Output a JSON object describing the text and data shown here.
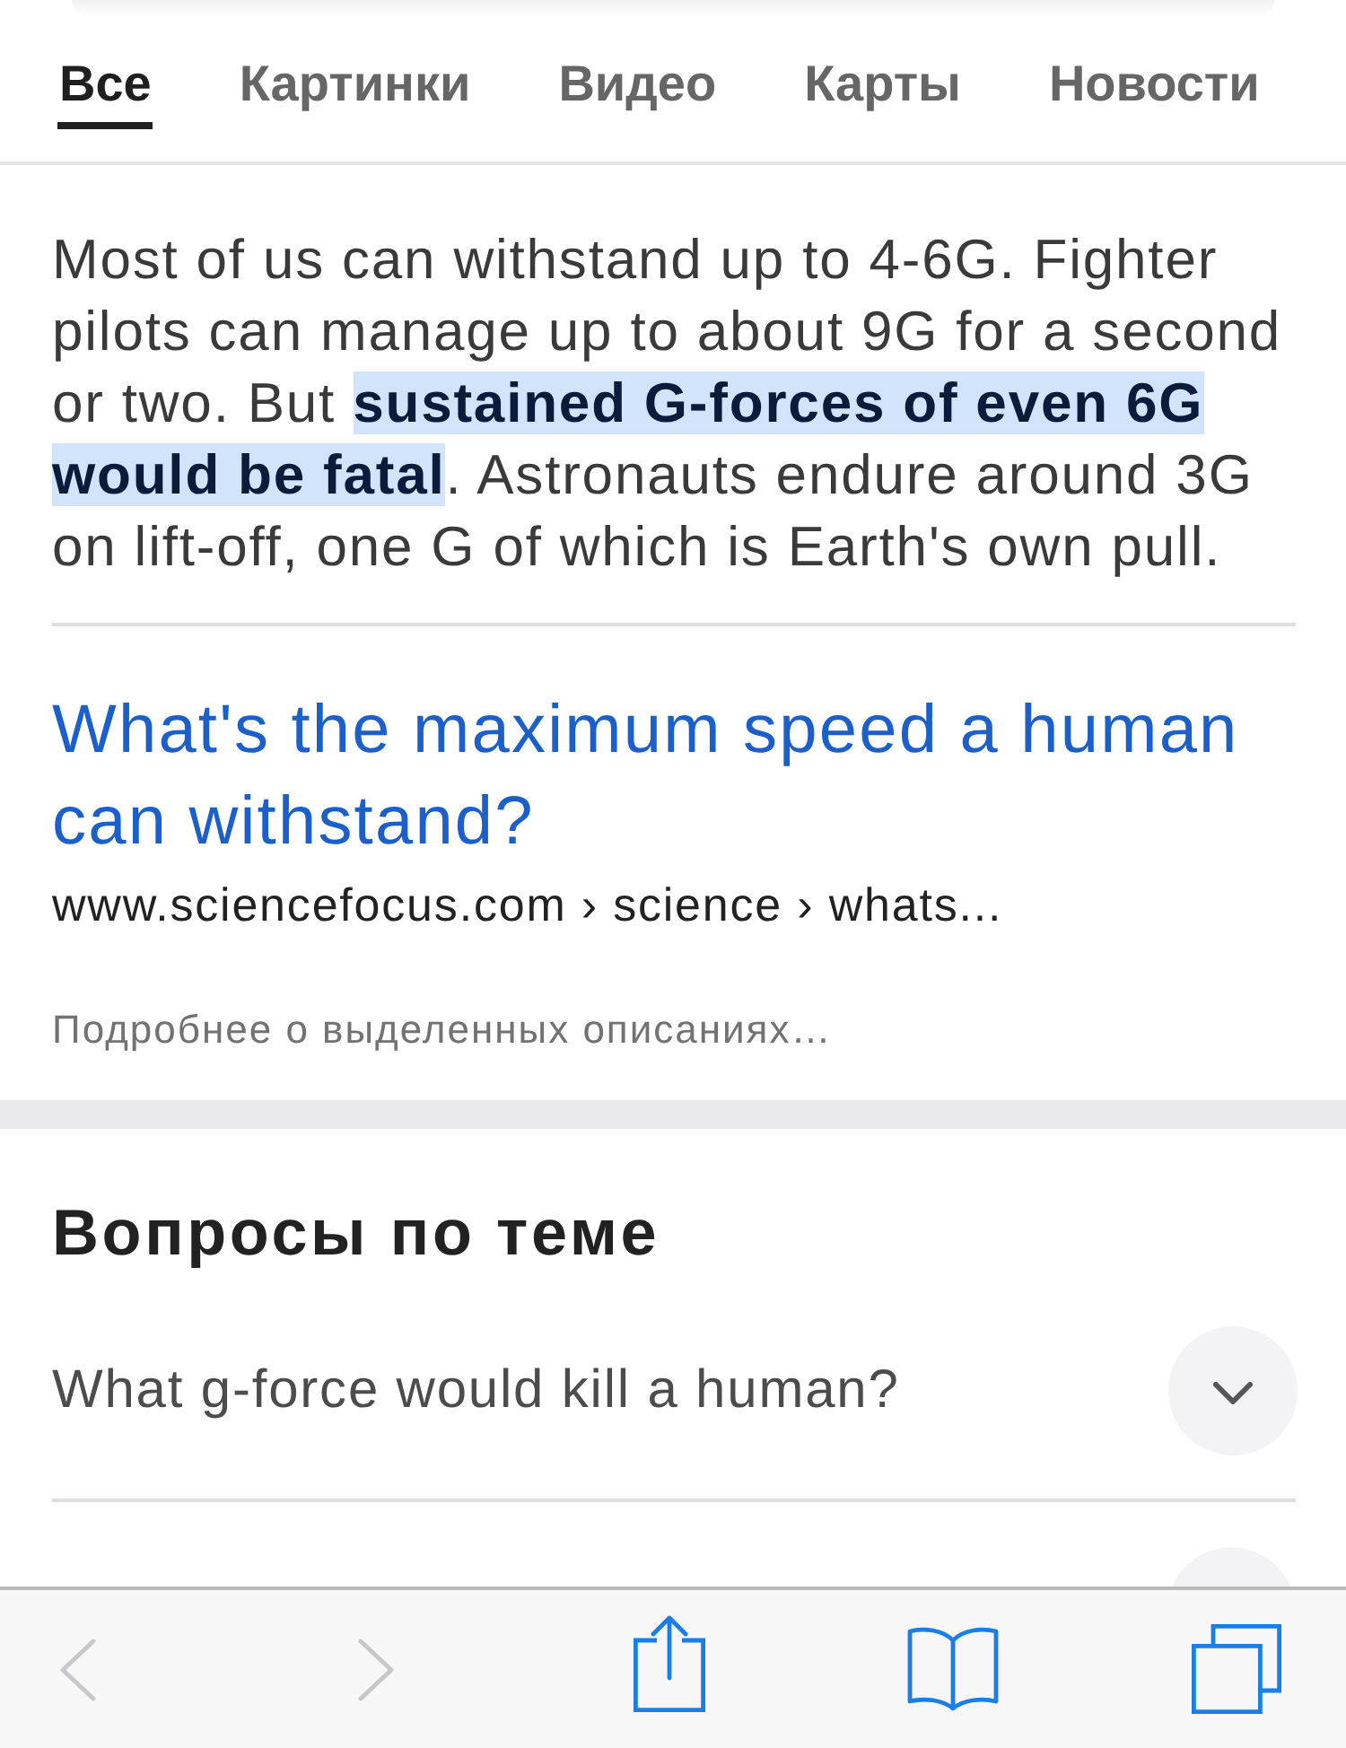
{
  "tabs": [
    {
      "label": "Все",
      "selected": true
    },
    {
      "label": "Картинки",
      "selected": false
    },
    {
      "label": "Видео",
      "selected": false
    },
    {
      "label": "Карты",
      "selected": false
    },
    {
      "label": "Новости",
      "selected": false
    }
  ],
  "featured_snippet": {
    "text": "Most of us can withstand up to 4-6G. Fighter pilots can manage up to about 9G for a second or two. But **sustained G-forces of even 6G would be fatal**. Astronauts endure around 3G on lift-off, one G of which is Earth's own pull.",
    "link_title": "What's the maximum speed a human can withstand?",
    "url": "www.sciencefocus.com › science › whats...",
    "about_link": "Подробнее о выделенных описаниях…"
  },
  "related_questions": {
    "heading": "Вопросы по теме",
    "items": [
      {
        "question": "What g-force would kill a human?",
        "expanded": false
      }
    ]
  },
  "toolbar": [
    {
      "kind": "back",
      "disabled": true
    },
    {
      "kind": "forward",
      "disabled": true
    },
    {
      "kind": "share",
      "disabled": false
    },
    {
      "kind": "bookmarks",
      "disabled": false
    },
    {
      "kind": "tabs",
      "disabled": false
    }
  ]
}
